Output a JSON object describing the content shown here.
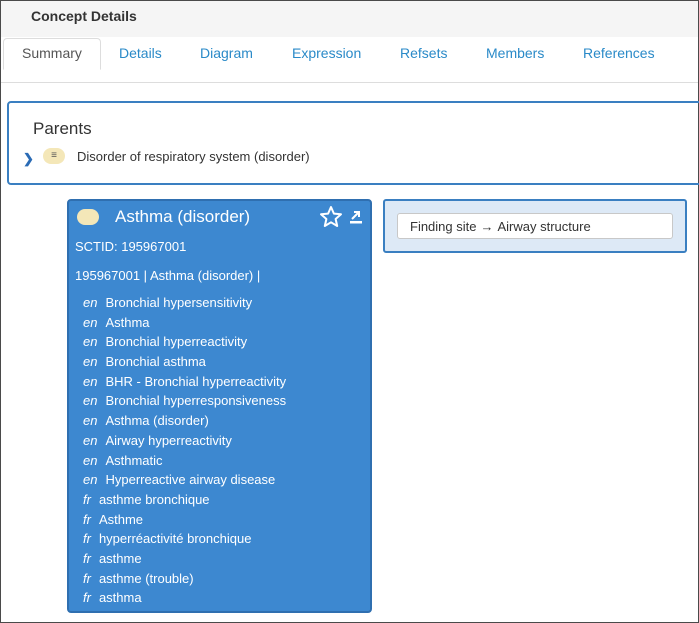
{
  "header": {
    "title": "Concept Details"
  },
  "tabs": [
    {
      "label": "Summary"
    },
    {
      "label": "Details"
    },
    {
      "label": "Diagram"
    },
    {
      "label": "Expression"
    },
    {
      "label": "Refsets"
    },
    {
      "label": "Members"
    },
    {
      "label": "References"
    }
  ],
  "parents": {
    "title": "Parents",
    "items": [
      {
        "label": "Disorder of respiratory system (disorder)",
        "badge": "≡"
      }
    ]
  },
  "concept": {
    "name": "Asthma (disorder)",
    "sctid": "SCTID: 195967001",
    "fsn_line": "195967001 | Asthma (disorder) |",
    "descriptions": [
      {
        "lang": "en",
        "text": "Bronchial hypersensitivity"
      },
      {
        "lang": "en",
        "text": "Asthma"
      },
      {
        "lang": "en",
        "text": "Bronchial hyperreactivity"
      },
      {
        "lang": "en",
        "text": "Bronchial asthma"
      },
      {
        "lang": "en",
        "text": "BHR - Bronchial hyperreactivity"
      },
      {
        "lang": "en",
        "text": "Bronchial hyperresponsiveness"
      },
      {
        "lang": "en",
        "text": "Asthma (disorder)"
      },
      {
        "lang": "en",
        "text": "Airway hyperreactivity"
      },
      {
        "lang": "en",
        "text": "Asthmatic"
      },
      {
        "lang": "en",
        "text": "Hyperreactive airway disease"
      },
      {
        "lang": "fr",
        "text": "asthme bronchique"
      },
      {
        "lang": "fr",
        "text": "Asthme"
      },
      {
        "lang": "fr",
        "text": "hyperréactivité bronchique"
      },
      {
        "lang": "fr",
        "text": "asthme"
      },
      {
        "lang": "fr",
        "text": "asthme (trouble)"
      },
      {
        "lang": "fr",
        "text": "asthma"
      }
    ]
  },
  "relationship": {
    "attribute": "Finding site",
    "arrow": "→",
    "value": "Airway structure"
  },
  "colors": {
    "accent": "#3d88d0",
    "link": "#2a8ac8",
    "pill": "#f4e7b8"
  }
}
